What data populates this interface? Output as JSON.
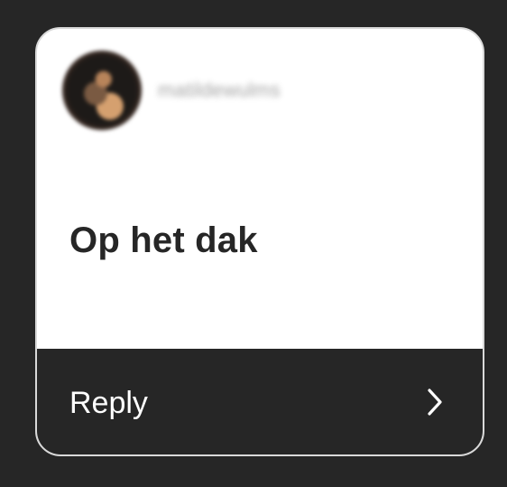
{
  "card": {
    "username": "matildewulms",
    "message": "Op het dak",
    "reply_label": "Reply"
  },
  "icons": {
    "avatar": "profile-avatar",
    "chevron": "chevron-right-icon"
  },
  "colors": {
    "background": "#262626",
    "card_background": "#ffffff",
    "card_border": "#d9d9d9",
    "message_text": "#262626",
    "reply_bar": "#262626",
    "reply_text": "#ffffff"
  }
}
